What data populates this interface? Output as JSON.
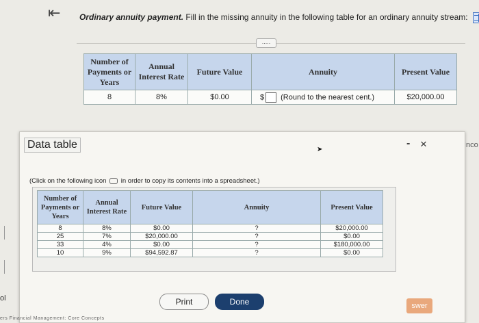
{
  "header": {
    "back_icon": "first-page-icon",
    "question_bold": "Ordinary annuity payment.",
    "question_text": "Fill in the missing annuity in the following table for an ordinary annuity stream:",
    "table_icon": "spreadsheet-icon",
    "more_label": "....."
  },
  "top_table": {
    "headers": [
      "Number of Payments or Years",
      "Annual Interest Rate",
      "Future Value",
      "Annuity",
      "Present Value"
    ],
    "row": {
      "years": "8",
      "rate": "8%",
      "future_value": "$0.00",
      "currency": "$",
      "annuity_input": "",
      "annuity_hint": "(Round to the nearest cent.)",
      "present_value": "$20,000.00"
    }
  },
  "modal": {
    "title": "Data table",
    "minimize": "-",
    "close": "×",
    "instruction_before": "(Click on the following icon",
    "instruction_after": "in order to copy its contents into a spreadsheet.)",
    "headers": [
      "Number of Payments or Years",
      "Annual Interest Rate",
      "Future Value",
      "Annuity",
      "Present Value"
    ],
    "rows": [
      {
        "years": "8",
        "rate": "8%",
        "fv": "$0.00",
        "annuity": "?",
        "pv": "$20,000.00"
      },
      {
        "years": "25",
        "rate": "7%",
        "fv": "$20,000.00",
        "annuity": "?",
        "pv": "$0.00"
      },
      {
        "years": "33",
        "rate": "4%",
        "fv": "$0.00",
        "annuity": "?",
        "pv": "$180,000.00"
      },
      {
        "years": "10",
        "rate": "9%",
        "fv": "$94,592.87",
        "annuity": "?",
        "pv": "$0.00"
      }
    ],
    "print_label": "Print",
    "done_label": "Done"
  },
  "background": {
    "right_cut_text": "Inco",
    "left_cut_text": "ol",
    "answer_button": "swer",
    "footer_text": "ers Financial Management: Core Concepts"
  }
}
